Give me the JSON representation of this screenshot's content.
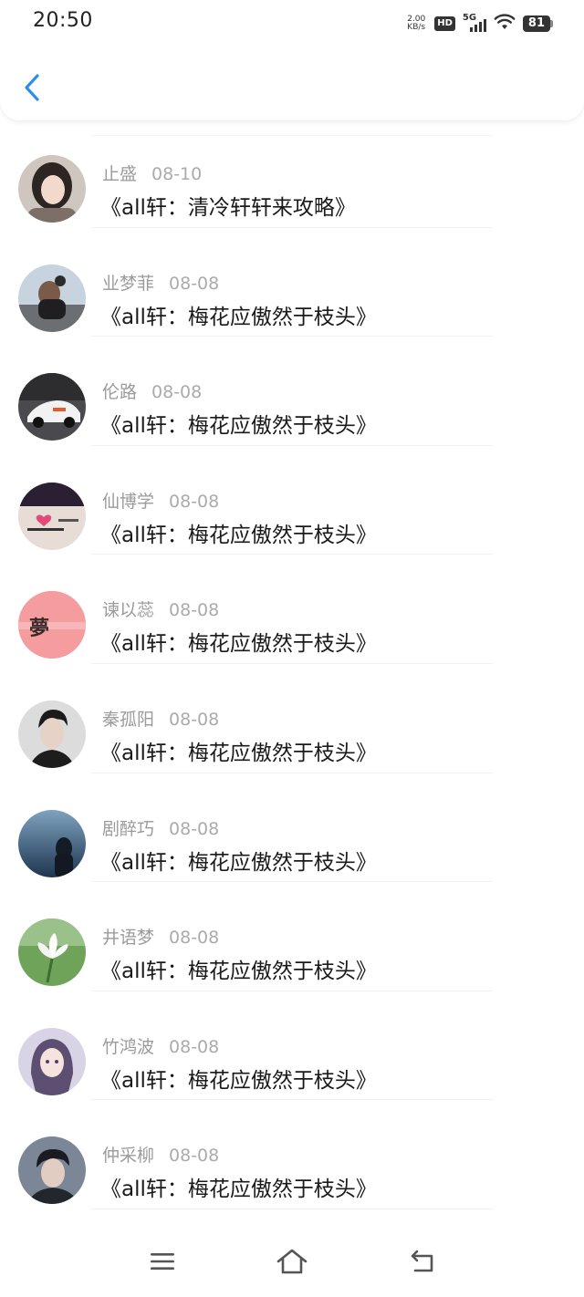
{
  "status_bar": {
    "time": "20:50",
    "net_speed_value": "2.00",
    "net_speed_unit": "KB/s",
    "hd_label": "HD",
    "network_label": "5G",
    "battery_level": "81"
  },
  "header": {
    "back_icon": "chevron-left-icon",
    "accent_color": "#2f8fe8"
  },
  "items": [
    {
      "author": "止盛",
      "date": "08-10",
      "title": "《all轩：清冷轩轩来攻略》"
    },
    {
      "author": "业梦菲",
      "date": "08-08",
      "title": "《all轩：梅花应傲然于枝头》"
    },
    {
      "author": "伦路",
      "date": "08-08",
      "title": "《all轩：梅花应傲然于枝头》"
    },
    {
      "author": "仙博学",
      "date": "08-08",
      "title": "《all轩：梅花应傲然于枝头》"
    },
    {
      "author": "谏以蕊",
      "date": "08-08",
      "title": "《all轩：梅花应傲然于枝头》"
    },
    {
      "author": "秦孤阳",
      "date": "08-08",
      "title": "《all轩：梅花应傲然于枝头》"
    },
    {
      "author": "剧醉巧",
      "date": "08-08",
      "title": "《all轩：梅花应傲然于枝头》"
    },
    {
      "author": "井语梦",
      "date": "08-08",
      "title": "《all轩：梅花应傲然于枝头》"
    },
    {
      "author": "竹鸿波",
      "date": "08-08",
      "title": "《all轩：梅花应傲然于枝头》"
    },
    {
      "author": "仲采柳",
      "date": "08-08",
      "title": "《all轩：梅花应傲然于枝头》"
    }
  ],
  "avatars": {
    "avatar_5_text": "夢"
  },
  "bottom_nav": {
    "menu_icon": "menu-icon",
    "home_icon": "home-icon",
    "back_icon": "back-icon"
  }
}
